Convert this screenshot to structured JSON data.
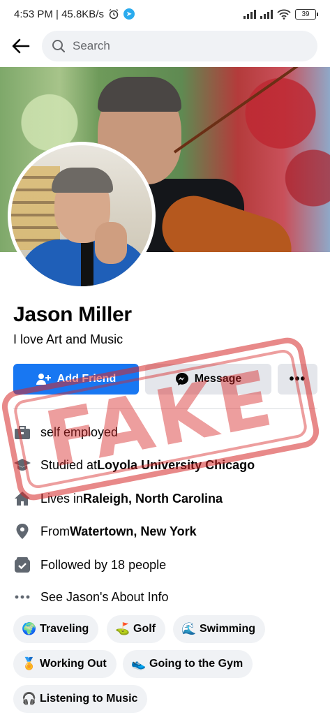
{
  "status_bar": {
    "time_speed": "4:53 PM | 45.8KB/s",
    "battery": "39"
  },
  "header": {
    "search_placeholder": "Search"
  },
  "profile": {
    "name": "Jason Miller",
    "bio": "I love Art and Music",
    "stamp_text": "FAKE"
  },
  "actions": {
    "add_friend": "Add Friend",
    "message": "Message",
    "more": "•••"
  },
  "info": [
    {
      "icon": "briefcase-icon",
      "pre": "self employed",
      "bold": ""
    },
    {
      "icon": "graduation-cap-icon",
      "pre": "Studied at ",
      "bold": "Loyola University Chicago"
    },
    {
      "icon": "home-icon",
      "pre": "Lives in ",
      "bold": "Raleigh, North Carolina"
    },
    {
      "icon": "location-pin-icon",
      "pre": "From ",
      "bold": "Watertown, New York"
    },
    {
      "icon": "followers-icon",
      "pre": "Followed by 18 people",
      "bold": ""
    },
    {
      "icon": "more-dots-icon",
      "pre": "See Jason's About Info",
      "bold": ""
    }
  ],
  "hobbies": [
    {
      "emoji": "🌍",
      "label": "Traveling"
    },
    {
      "emoji": "⛳",
      "label": "Golf"
    },
    {
      "emoji": "🌊",
      "label": "Swimming"
    },
    {
      "emoji": "🏅",
      "label": "Working Out"
    },
    {
      "emoji": "👟",
      "label": "Going to the Gym"
    },
    {
      "emoji": "🎧",
      "label": "Listening to Music"
    }
  ],
  "colors": {
    "primary": "#1877f2",
    "secondary_button": "#e4e6eb",
    "chip": "#f0f2f5",
    "stamp": "#d62828"
  }
}
